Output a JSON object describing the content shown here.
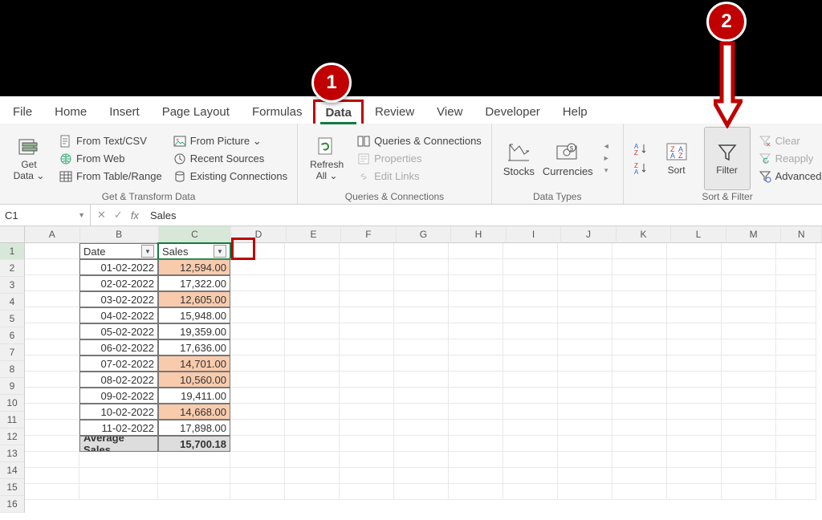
{
  "callouts": {
    "n1": "1",
    "n2": "2"
  },
  "tabs": {
    "file": "File",
    "home": "Home",
    "insert": "Insert",
    "pagelayout": "Page Layout",
    "formulas": "Formulas",
    "data": "Data",
    "review": "Review",
    "view": "View",
    "developer": "Developer",
    "help": "Help"
  },
  "ribbon": {
    "getdata": {
      "label": "Get\nData ⌄",
      "from_text": "From Text/CSV",
      "from_web": "From Web",
      "from_table": "From Table/Range",
      "from_picture": "From Picture ⌄",
      "recent_sources": "Recent Sources",
      "existing_conn": "Existing Connections",
      "group": "Get & Transform Data"
    },
    "queries": {
      "refresh": "Refresh\nAll ⌄",
      "qc": "Queries & Connections",
      "props": "Properties",
      "edit_links": "Edit Links",
      "group": "Queries & Connections"
    },
    "datatypes": {
      "stocks": "Stocks",
      "currencies": "Currencies",
      "group": "Data Types"
    },
    "sortfilter": {
      "sort": "Sort",
      "filter": "Filter",
      "clear": "Clear",
      "reapply": "Reapply",
      "advanced": "Advanced",
      "group": "Sort & Filter"
    }
  },
  "namebox": "C1",
  "formula": "Sales",
  "columns": [
    "A",
    "B",
    "C",
    "D",
    "E",
    "F",
    "G",
    "H",
    "I",
    "J",
    "K",
    "L",
    "M",
    "N"
  ],
  "rows": [
    "1",
    "2",
    "3",
    "4",
    "5",
    "6",
    "7",
    "8",
    "9",
    "10",
    "11",
    "12",
    "13",
    "14",
    "15",
    "16"
  ],
  "headers": {
    "B": "Date",
    "C": "Sales"
  },
  "table": [
    {
      "date": "01-02-2022",
      "sales": "12,594.00",
      "hl": true
    },
    {
      "date": "02-02-2022",
      "sales": "17,322.00",
      "hl": false
    },
    {
      "date": "03-02-2022",
      "sales": "12,605.00",
      "hl": true
    },
    {
      "date": "04-02-2022",
      "sales": "15,948.00",
      "hl": false
    },
    {
      "date": "05-02-2022",
      "sales": "19,359.00",
      "hl": false
    },
    {
      "date": "06-02-2022",
      "sales": "17,636.00",
      "hl": false
    },
    {
      "date": "07-02-2022",
      "sales": "14,701.00",
      "hl": true
    },
    {
      "date": "08-02-2022",
      "sales": "10,560.00",
      "hl": true
    },
    {
      "date": "09-02-2022",
      "sales": "19,411.00",
      "hl": false
    },
    {
      "date": "10-02-2022",
      "sales": "14,668.00",
      "hl": true
    },
    {
      "date": "11-02-2022",
      "sales": "17,898.00",
      "hl": false
    }
  ],
  "summary": {
    "label": "Average Sales",
    "value": "15,700.18"
  }
}
